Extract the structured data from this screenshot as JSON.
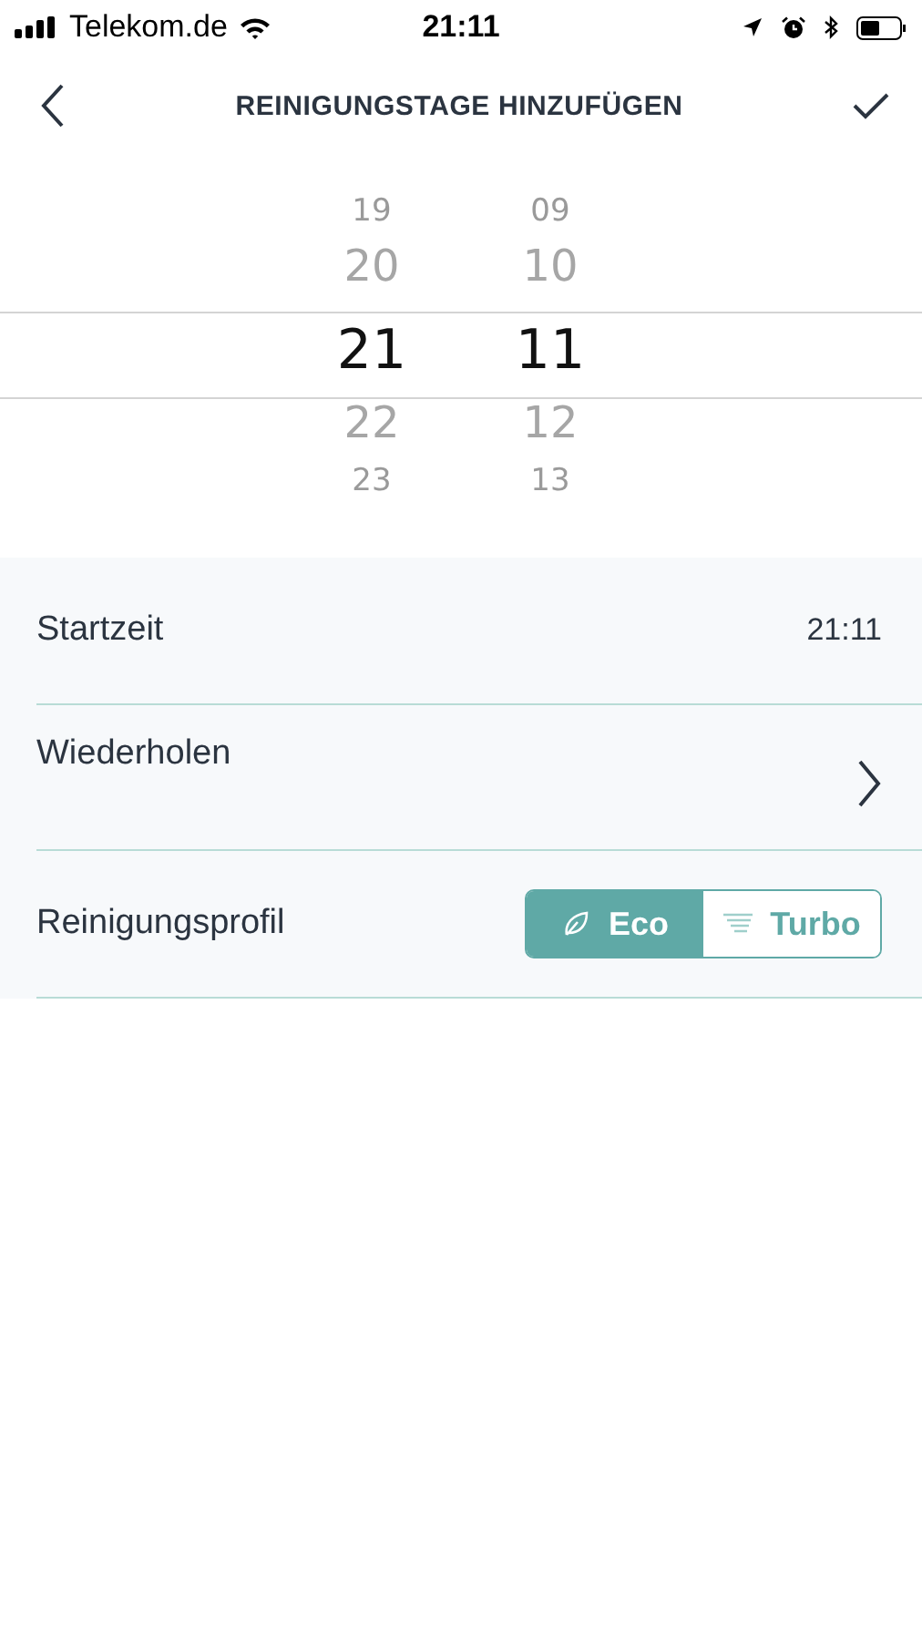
{
  "status_bar": {
    "carrier": "Telekom.de",
    "time": "21:11"
  },
  "nav": {
    "title": "REINIGUNGSTAGE HINZUFÜGEN"
  },
  "picker": {
    "columns": [
      {
        "items": [
          {
            "label": "19",
            "selected": false
          },
          {
            "label": "20",
            "selected": false
          },
          {
            "label": "21",
            "selected": true
          },
          {
            "label": "22",
            "selected": false
          },
          {
            "label": "23",
            "selected": false
          }
        ]
      },
      {
        "items": [
          {
            "label": "09",
            "selected": false
          },
          {
            "label": "10",
            "selected": false
          },
          {
            "label": "11",
            "selected": true
          },
          {
            "label": "12",
            "selected": false
          },
          {
            "label": "13",
            "selected": false
          }
        ]
      }
    ]
  },
  "settings": [
    {
      "kind": "value",
      "label": "Startzeit",
      "value": "21:11"
    },
    {
      "kind": "link",
      "label": "Wiederholen"
    },
    {
      "kind": "segmented",
      "label": "Reinigungsprofil",
      "options": [
        {
          "label": "Eco",
          "selected": true
        },
        {
          "label": "Turbo",
          "selected": false
        }
      ]
    }
  ]
}
